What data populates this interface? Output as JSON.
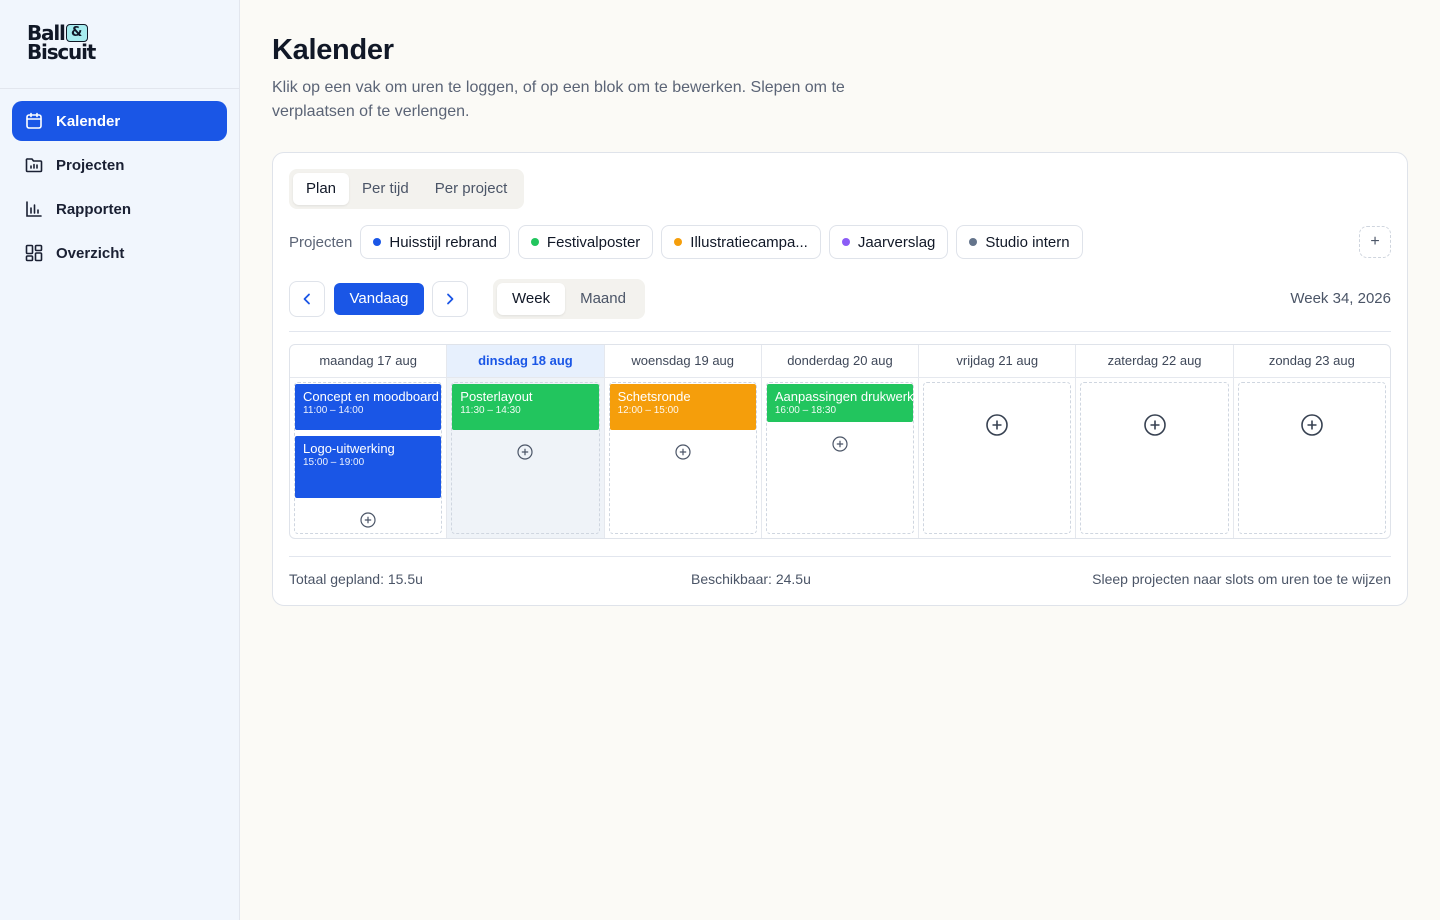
{
  "brand": {
    "line1": "Ball",
    "amp": "&",
    "line2": "Biscuit"
  },
  "sidebar": {
    "items": [
      {
        "label": "Kalender",
        "icon": "calendar-icon",
        "active": true
      },
      {
        "label": "Projecten",
        "icon": "folder-chart-icon",
        "active": false
      },
      {
        "label": "Rapporten",
        "icon": "bar-chart-icon",
        "active": false
      },
      {
        "label": "Overzicht",
        "icon": "dashboard-grid-icon",
        "active": false
      }
    ]
  },
  "page": {
    "title": "Kalender",
    "subtitle": "Klik op een vak om uren te loggen, of op een blok om te bewerken. Slepen om te verplaatsen of te verlengen."
  },
  "tabs": {
    "plan": "Plan",
    "per_tijd": "Per tijd",
    "per_project": "Per project",
    "active": "Plan"
  },
  "projects": {
    "label": "Projecten",
    "add_label": "+",
    "items": [
      {
        "name": "Huisstijl rebrand",
        "color": "#1a56e6"
      },
      {
        "name": "Festivalposter",
        "color": "#22c55e"
      },
      {
        "name": "Illustratiecampa...",
        "color": "#f59e0b"
      },
      {
        "name": "Jaarverslag",
        "color": "#8b5cf6"
      },
      {
        "name": "Studio intern",
        "color": "#64748b"
      }
    ]
  },
  "toolbar": {
    "today": "Vandaag",
    "week": "Week",
    "month": "Maand",
    "active_view": "Week",
    "week_label": "Week 34, 2026"
  },
  "days": [
    {
      "label": "maandag 17 aug",
      "today": false
    },
    {
      "label": "dinsdag 18 aug",
      "today": true
    },
    {
      "label": "woensdag 19 aug",
      "today": false
    },
    {
      "label": "donderdag 20 aug",
      "today": false
    },
    {
      "label": "vrijdag 21 aug",
      "today": false
    },
    {
      "label": "zaterdag 22 aug",
      "today": false
    },
    {
      "label": "zondag 23 aug",
      "today": false
    }
  ],
  "events": [
    {
      "day": 0,
      "title": "Concept en moodboard",
      "time": "11:00 – 14:00",
      "color": "#1a56e6"
    },
    {
      "day": 0,
      "title": "Logo-uitwerking",
      "time": "15:00 – 19:00",
      "color": "#1a56e6"
    },
    {
      "day": 1,
      "title": "Posterlayout",
      "time": "11:30 – 14:30",
      "color": "#22c55e"
    },
    {
      "day": 2,
      "title": "Schetsronde",
      "time": "12:00 – 15:00",
      "color": "#f59e0b"
    },
    {
      "day": 3,
      "title": "Aanpassingen drukwerk",
      "time": "16:00 – 18:30",
      "color": "#22c55e"
    }
  ],
  "footer": {
    "total": "Totaal gepland: 15.5u",
    "available": "Beschikbaar: 24.5u",
    "hint": "Sleep projecten naar slots om uren toe te wijzen"
  }
}
